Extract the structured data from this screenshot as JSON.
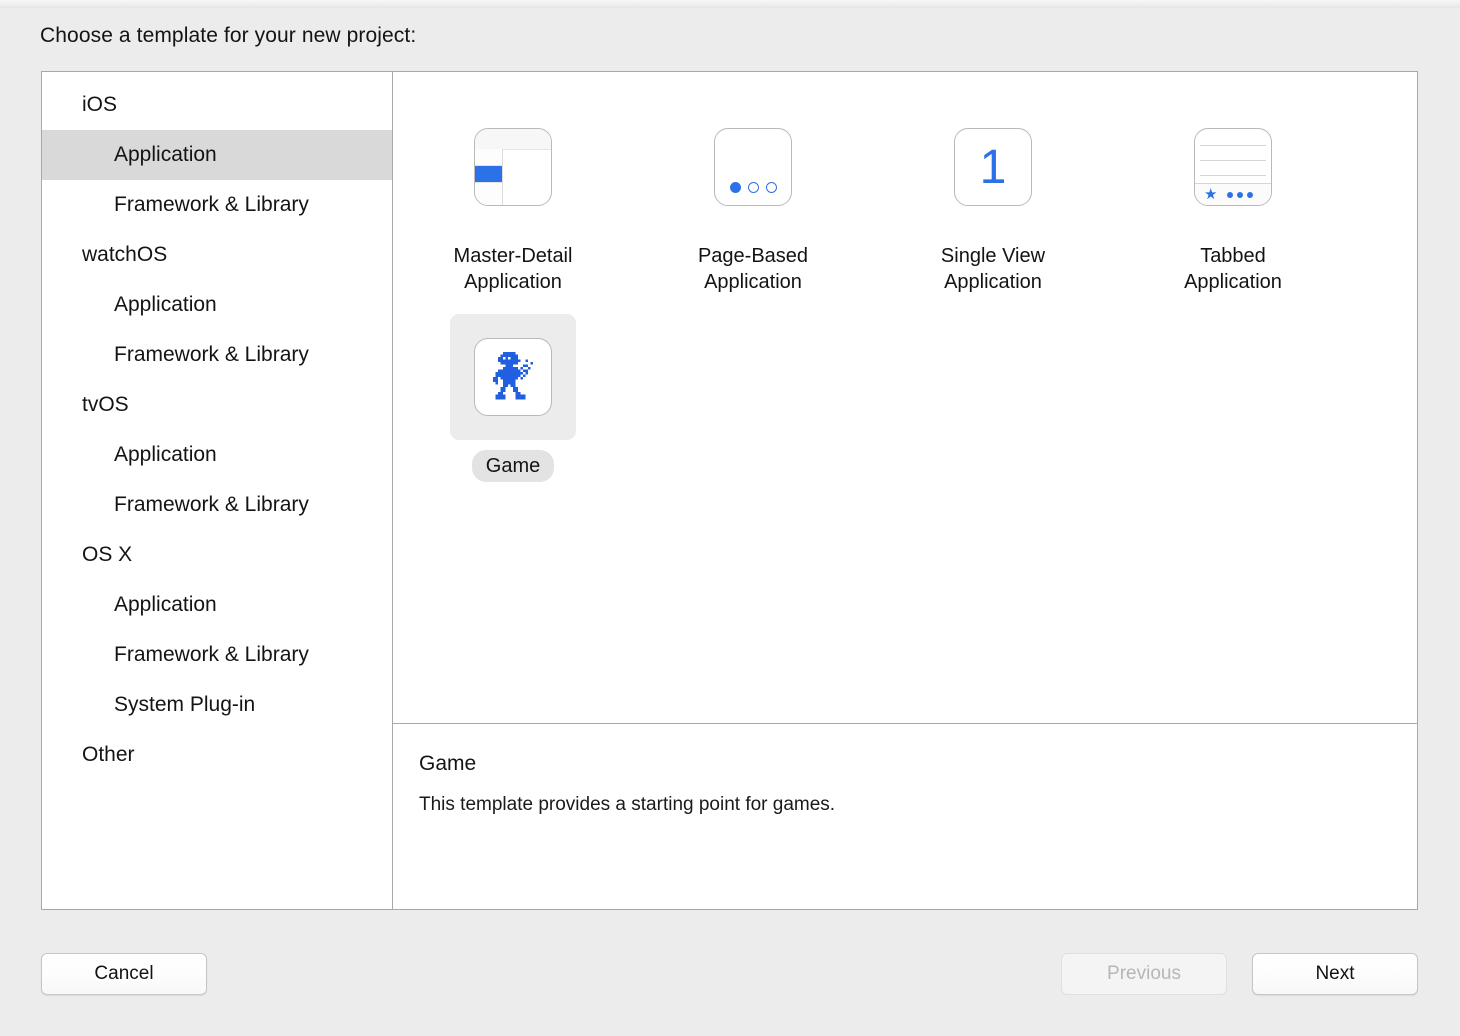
{
  "prompt": "Choose a template for your new project:",
  "sidebar": {
    "items": [
      {
        "label": "iOS",
        "level": "group",
        "selected": false
      },
      {
        "label": "Application",
        "level": "child",
        "selected": true
      },
      {
        "label": "Framework & Library",
        "level": "child",
        "selected": false
      },
      {
        "label": "watchOS",
        "level": "group",
        "selected": false
      },
      {
        "label": "Application",
        "level": "child",
        "selected": false
      },
      {
        "label": "Framework & Library",
        "level": "child",
        "selected": false
      },
      {
        "label": "tvOS",
        "level": "group",
        "selected": false
      },
      {
        "label": "Application",
        "level": "child",
        "selected": false
      },
      {
        "label": "Framework & Library",
        "level": "child",
        "selected": false
      },
      {
        "label": "OS X",
        "level": "group",
        "selected": false
      },
      {
        "label": "Application",
        "level": "child",
        "selected": false
      },
      {
        "label": "Framework & Library",
        "level": "child",
        "selected": false
      },
      {
        "label": "System Plug-in",
        "level": "child",
        "selected": false
      },
      {
        "label": "Other",
        "level": "group",
        "selected": false
      }
    ]
  },
  "templates": [
    {
      "label": "Master-Detail\nApplication",
      "icon": "master-detail-icon",
      "selected": false
    },
    {
      "label": "Page-Based\nApplication",
      "icon": "page-based-icon",
      "selected": false
    },
    {
      "label": "Single View\nApplication",
      "icon": "single-view-icon",
      "numeral": "1",
      "selected": false
    },
    {
      "label": "Tabbed\nApplication",
      "icon": "tabbed-icon",
      "selected": false
    },
    {
      "label": "Game",
      "icon": "game-robot-icon",
      "selected": true
    }
  ],
  "description": {
    "title": "Game",
    "body": "This template provides a starting point for games."
  },
  "footer": {
    "cancel": "Cancel",
    "previous": "Previous",
    "next": "Next"
  },
  "colors": {
    "accent_blue": "#2b72e8",
    "selection_grey": "#d9d9d9",
    "window_bg": "#ececec",
    "border": "#a8a8a8"
  }
}
